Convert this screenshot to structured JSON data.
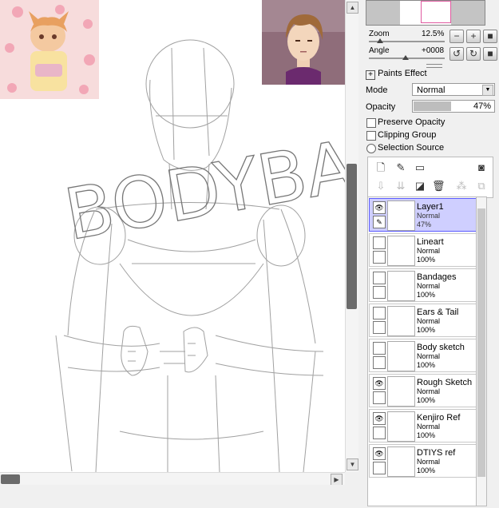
{
  "navigator": {
    "zoom_label": "Zoom",
    "zoom_value": "12.5%",
    "angle_label": "Angle",
    "angle_value": "+0008"
  },
  "paints_effect": {
    "header": "Paints Effect",
    "mode_label": "Mode",
    "mode_value": "Normal",
    "opacity_label": "Opacity",
    "opacity_value": "47%",
    "opacity_fraction": 0.47,
    "preserve_opacity": "Preserve Opacity",
    "clipping_group": "Clipping Group",
    "selection_source": "Selection Source"
  },
  "canvas": {
    "watermark": "BODYBAGZ"
  },
  "layers": [
    {
      "name": "Layer1",
      "mode": "Normal",
      "opacity": "47%",
      "visible": true,
      "selected": true
    },
    {
      "name": "Lineart",
      "mode": "Normal",
      "opacity": "100%",
      "visible": false,
      "selected": false
    },
    {
      "name": "Bandages",
      "mode": "Normal",
      "opacity": "100%",
      "visible": false,
      "selected": false
    },
    {
      "name": "Ears & Tail",
      "mode": "Normal",
      "opacity": "100%",
      "visible": false,
      "selected": false
    },
    {
      "name": "Body sketch",
      "mode": "Normal",
      "opacity": "100%",
      "visible": false,
      "selected": false
    },
    {
      "name": "Rough Sketch",
      "mode": "Normal",
      "opacity": "100%",
      "visible": true,
      "selected": false
    },
    {
      "name": "Kenjiro Ref",
      "mode": "Normal",
      "opacity": "100%",
      "visible": true,
      "selected": false
    },
    {
      "name": "DTIYS ref",
      "mode": "Normal",
      "opacity": "100%",
      "visible": true,
      "selected": false
    }
  ],
  "colors": {
    "selected_layer": "#cfcfff",
    "selected_border": "#5a5aff",
    "scroll_thumb": "#6b6b6b"
  }
}
